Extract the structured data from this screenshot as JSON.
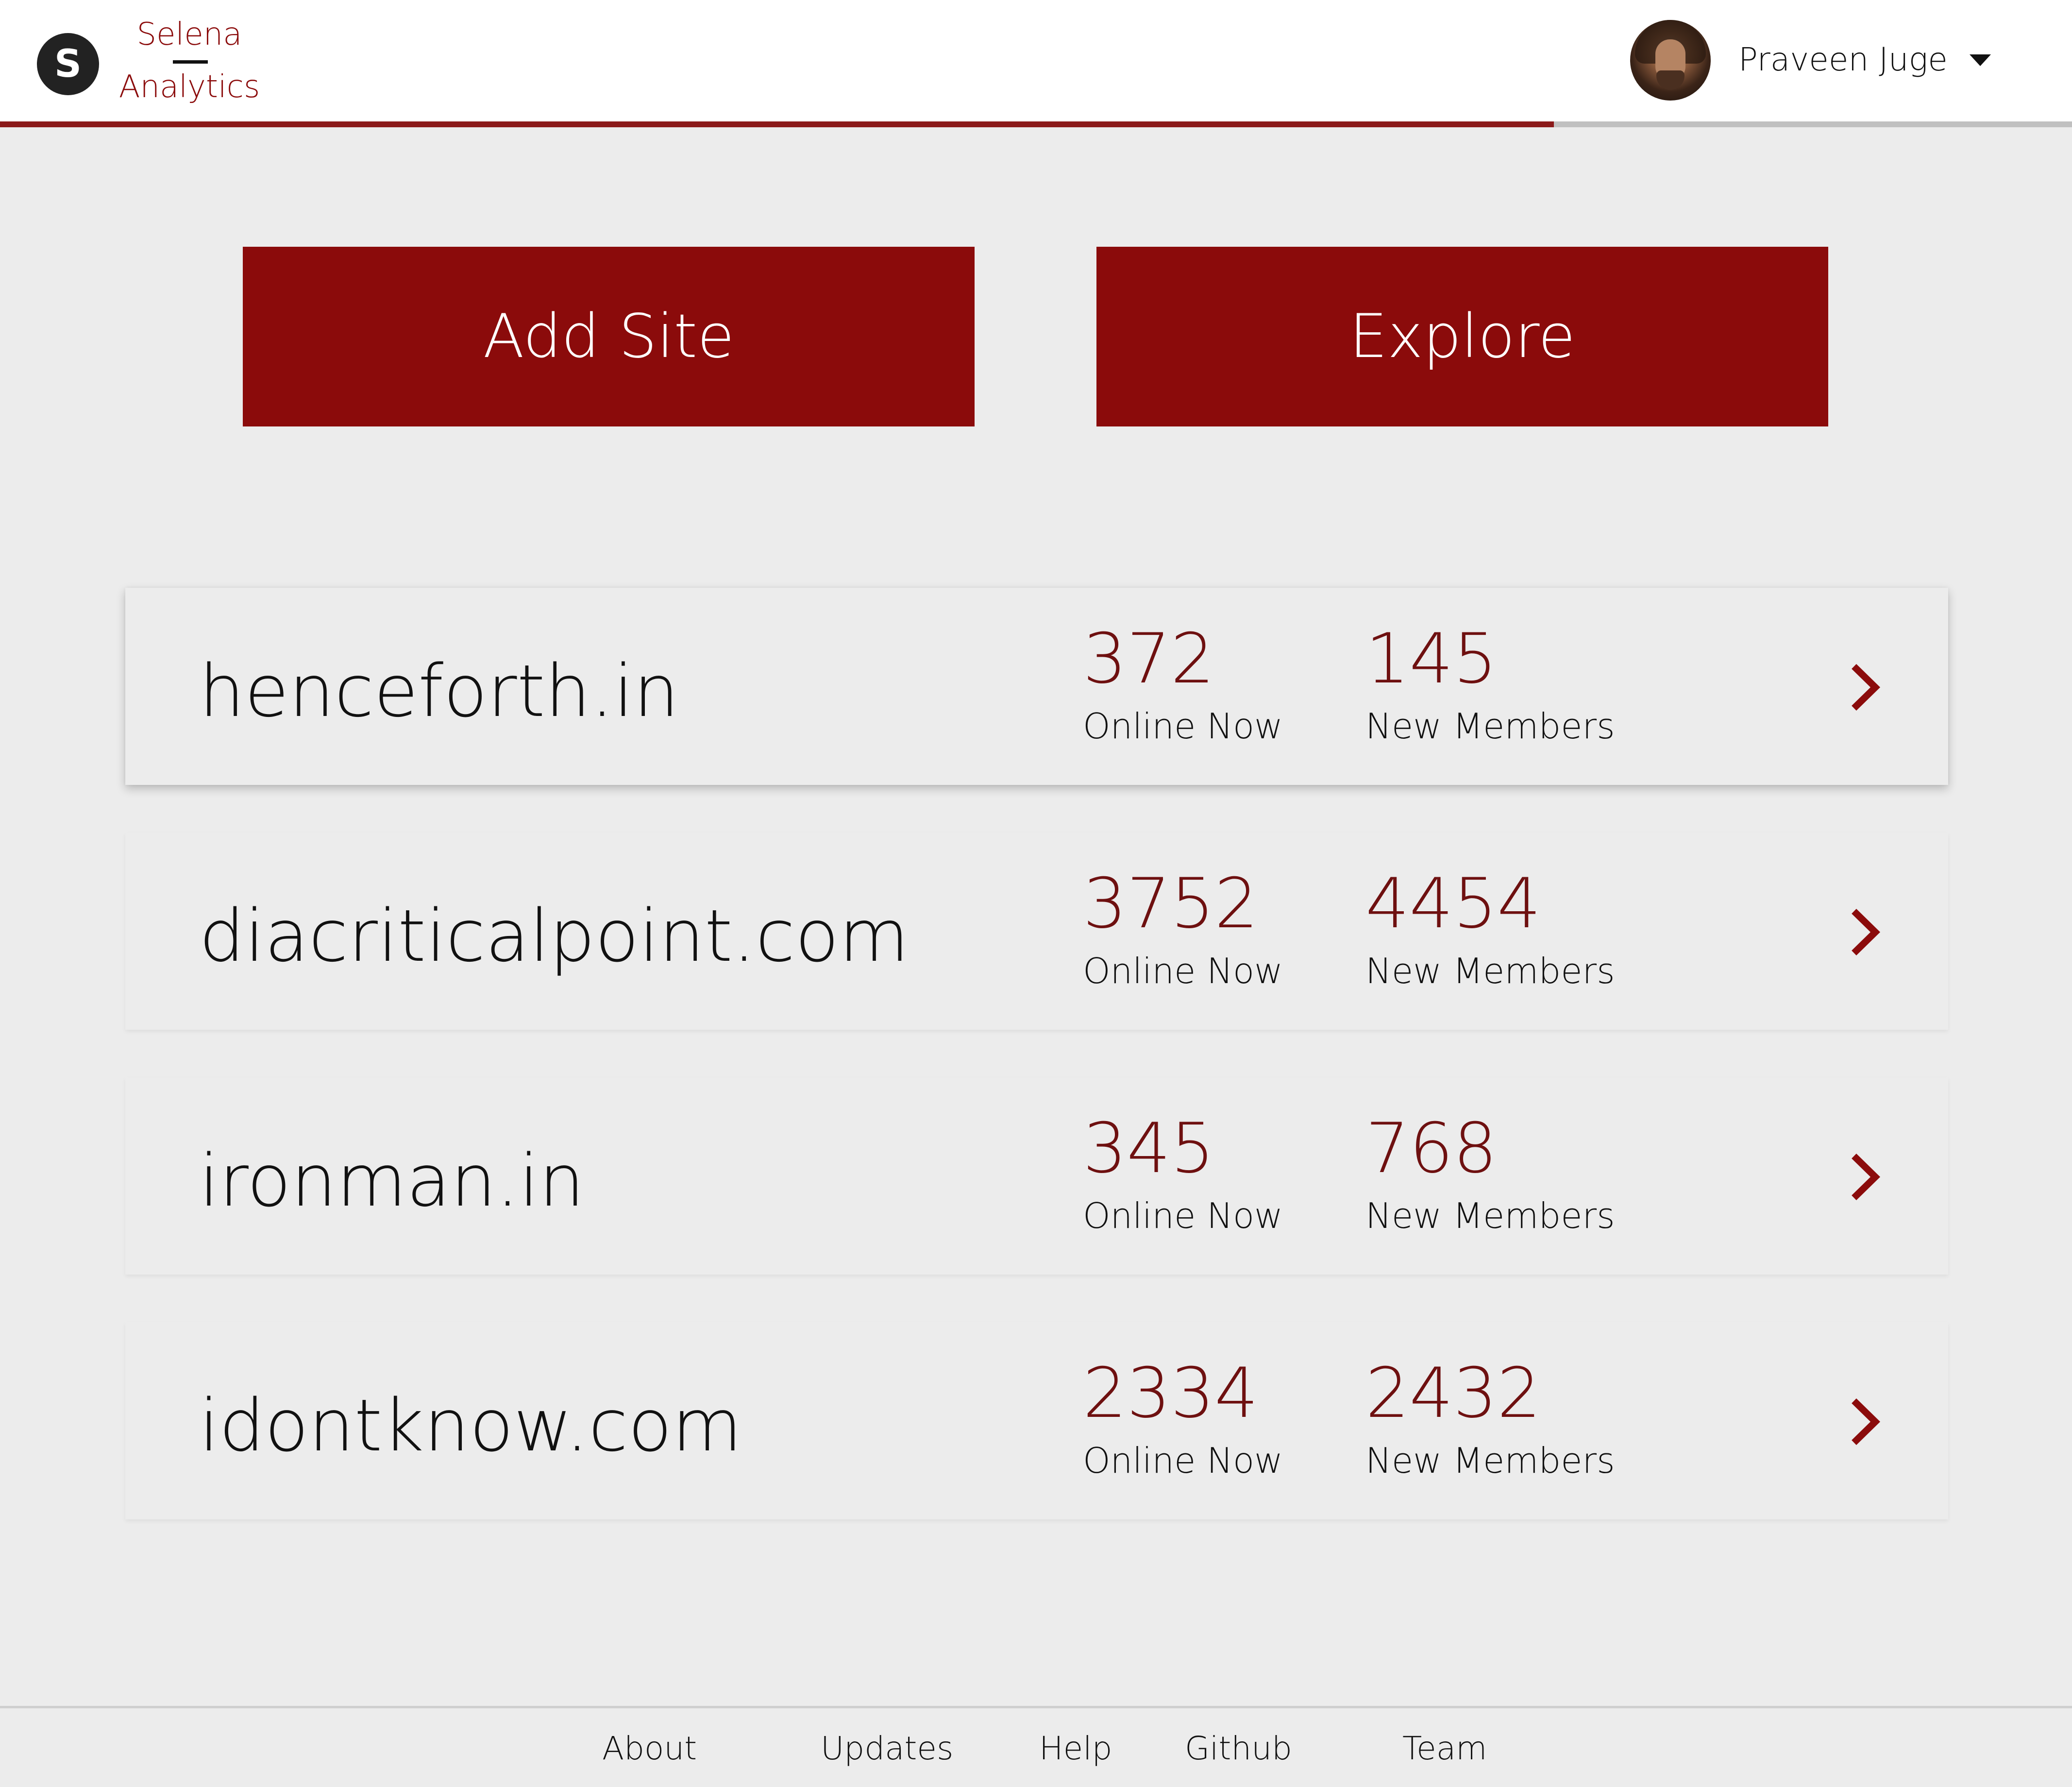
{
  "header": {
    "logo_letter": "S",
    "brand_line1": "Selena",
    "brand_line2": "Analytics",
    "user_name": "Praveen Juge",
    "progress_fraction": 0.75,
    "accent_color": "#8b0b0b"
  },
  "actions": {
    "add_site_label": "Add Site",
    "explore_label": "Explore"
  },
  "sites": [
    {
      "name": "henceforth.in",
      "online_now": "372",
      "online_label": "Online Now",
      "new_members": "145",
      "members_label": "New Members"
    },
    {
      "name": "diacriticalpoint.com",
      "online_now": "3752",
      "online_label": "Online Now",
      "new_members": "4454",
      "members_label": "New Members"
    },
    {
      "name": "ironman.in",
      "online_now": "345",
      "online_label": "Online Now",
      "new_members": "768",
      "members_label": "New Members"
    },
    {
      "name": "idontknow.com",
      "online_now": "2334",
      "online_label": "Online Now",
      "new_members": "2432",
      "members_label": "New Members"
    }
  ],
  "footer": {
    "links": [
      "About",
      "Updates",
      "Help",
      "Github",
      "Team"
    ]
  },
  "icons": {
    "logo": "logo-icon",
    "avatar": "user-avatar",
    "caret": "chevron-down-icon",
    "row_arrow": "chevron-right-icon"
  }
}
